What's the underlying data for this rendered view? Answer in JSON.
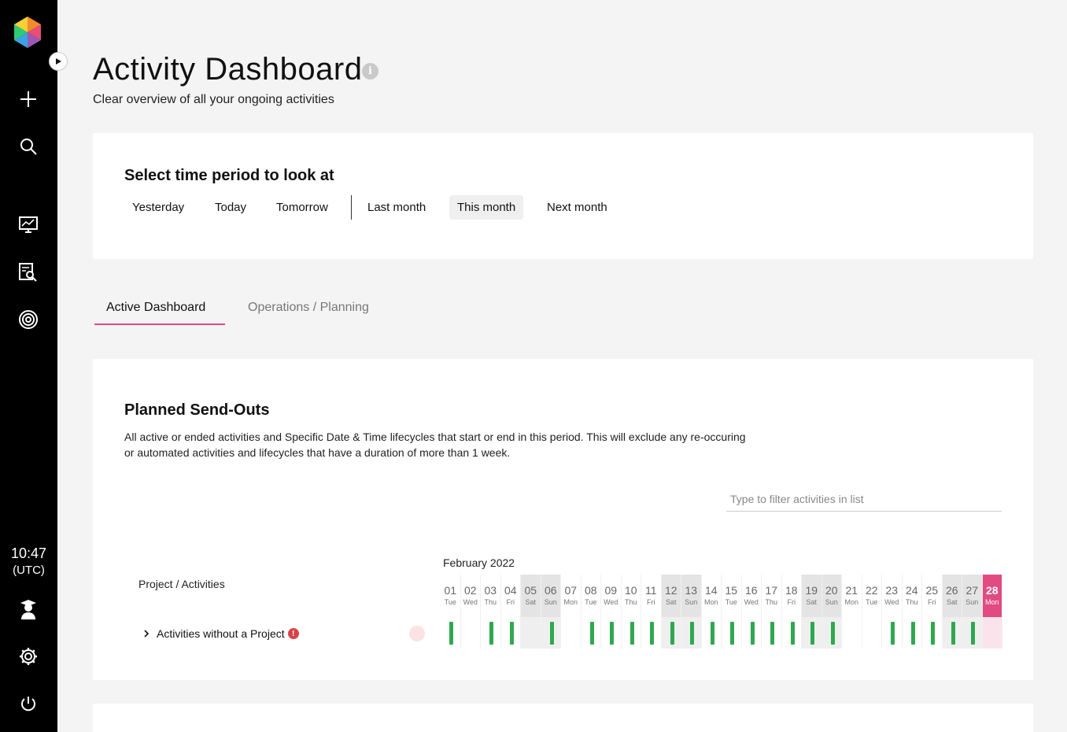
{
  "sidebar": {
    "icons": [
      "logo-icon",
      "plus-icon",
      "search-icon",
      "monitor-chart-icon",
      "report-search-icon",
      "target-icon",
      "user-graduate-icon",
      "gear-icon",
      "power-icon"
    ],
    "clock": {
      "time": "10:47",
      "zone": "(UTC)"
    }
  },
  "header": {
    "title": "Activity Dashboard",
    "subtitle": "Clear overview of all your ongoing activities"
  },
  "time_period": {
    "title": "Select time period to look at",
    "options": [
      "Yesterday",
      "Today",
      "Tomorrow",
      "Last month",
      "This month",
      "Next month"
    ],
    "selected": "This month"
  },
  "tabs": [
    {
      "label": "Active Dashboard",
      "active": true
    },
    {
      "label": "Operations / Planning",
      "active": false
    }
  ],
  "send_outs": {
    "title": "Planned Send-Outs",
    "description": "All active or ended activities and Specific Date & Time lifecycles that start or end in this period. This will exclude any re-occuring or automated activities and lifecycles that have a duration of more than 1 week.",
    "filter_placeholder": "Type to filter activities in list",
    "month": "February 2022",
    "column_header": "Project / Activities",
    "row_label": "Activities without a Project",
    "days": [
      {
        "num": "01",
        "dow": "Tue",
        "weekend": false,
        "active": true
      },
      {
        "num": "02",
        "dow": "Wed",
        "weekend": false,
        "active": false
      },
      {
        "num": "03",
        "dow": "Thu",
        "weekend": false,
        "active": true
      },
      {
        "num": "04",
        "dow": "Fri",
        "weekend": false,
        "active": true
      },
      {
        "num": "05",
        "dow": "Sat",
        "weekend": true,
        "active": false
      },
      {
        "num": "06",
        "dow": "Sun",
        "weekend": true,
        "active": true
      },
      {
        "num": "07",
        "dow": "Mon",
        "weekend": false,
        "active": false
      },
      {
        "num": "08",
        "dow": "Tue",
        "weekend": false,
        "active": true
      },
      {
        "num": "09",
        "dow": "Wed",
        "weekend": false,
        "active": true
      },
      {
        "num": "10",
        "dow": "Thu",
        "weekend": false,
        "active": true
      },
      {
        "num": "11",
        "dow": "Fri",
        "weekend": false,
        "active": true
      },
      {
        "num": "12",
        "dow": "Sat",
        "weekend": true,
        "active": true
      },
      {
        "num": "13",
        "dow": "Sun",
        "weekend": true,
        "active": true
      },
      {
        "num": "14",
        "dow": "Mon",
        "weekend": false,
        "active": true
      },
      {
        "num": "15",
        "dow": "Tue",
        "weekend": false,
        "active": true
      },
      {
        "num": "16",
        "dow": "Wed",
        "weekend": false,
        "active": true
      },
      {
        "num": "17",
        "dow": "Thu",
        "weekend": false,
        "active": true
      },
      {
        "num": "18",
        "dow": "Fri",
        "weekend": false,
        "active": true
      },
      {
        "num": "19",
        "dow": "Sat",
        "weekend": true,
        "active": true
      },
      {
        "num": "20",
        "dow": "Sun",
        "weekend": true,
        "active": true
      },
      {
        "num": "21",
        "dow": "Mon",
        "weekend": false,
        "active": false
      },
      {
        "num": "22",
        "dow": "Tue",
        "weekend": false,
        "active": false
      },
      {
        "num": "23",
        "dow": "Wed",
        "weekend": false,
        "active": true
      },
      {
        "num": "24",
        "dow": "Thu",
        "weekend": false,
        "active": true
      },
      {
        "num": "25",
        "dow": "Fri",
        "weekend": false,
        "active": true
      },
      {
        "num": "26",
        "dow": "Sat",
        "weekend": true,
        "active": true
      },
      {
        "num": "27",
        "dow": "Sun",
        "weekend": true,
        "active": true
      },
      {
        "num": "28",
        "dow": "Mon",
        "weekend": false,
        "active": false,
        "today": true
      }
    ]
  },
  "colors": {
    "accent": "#e24a82",
    "activity": "#2fa84f",
    "sidebar": "#000000"
  }
}
